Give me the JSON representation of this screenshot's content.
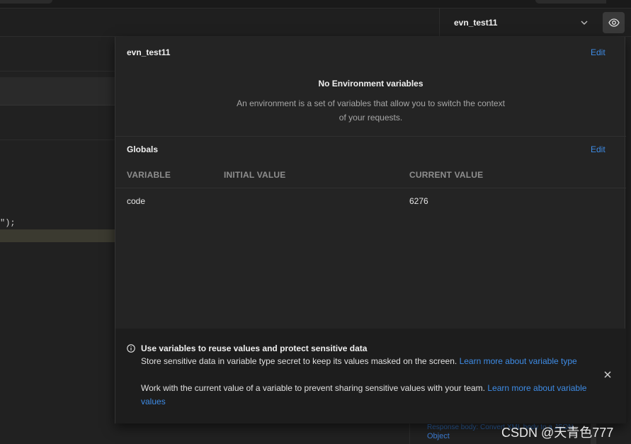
{
  "environment_selector": {
    "selected": "evn_test11"
  },
  "background": {
    "code_fragment": "\");",
    "snippet_lines": [
      "Response body: Convert XML body to a JSON",
      "Object"
    ]
  },
  "popover": {
    "env_name": "evn_test11",
    "edit_label": "Edit",
    "empty_title": "No Environment variables",
    "empty_desc": "An environment is a set of variables that allow you to switch the context of your requests.",
    "globals_title": "Globals",
    "globals_edit_label": "Edit",
    "columns": [
      "VARIABLE",
      "INITIAL VALUE",
      "CURRENT VALUE"
    ],
    "rows": [
      {
        "variable": "code",
        "initial": "",
        "current": "6276"
      }
    ]
  },
  "info_banner": {
    "title": "Use variables to reuse values and protect sensitive data",
    "line1_text": "Store sensitive data in variable type secret to keep its values masked on the screen. ",
    "line1_link": "Learn more about variable type",
    "line2_text": "Work with the current value of a variable to prevent sharing sensitive values with your team. ",
    "line2_link": "Learn more about variable values"
  },
  "watermark": "CSDN @天青色777",
  "colors": {
    "accent_link": "#3e8ce6",
    "panel_bg": "#242424",
    "banner_bg": "#1d1d1d"
  },
  "icons": [
    "chevron-down-icon",
    "eye-icon",
    "info-icon",
    "close-icon"
  ]
}
